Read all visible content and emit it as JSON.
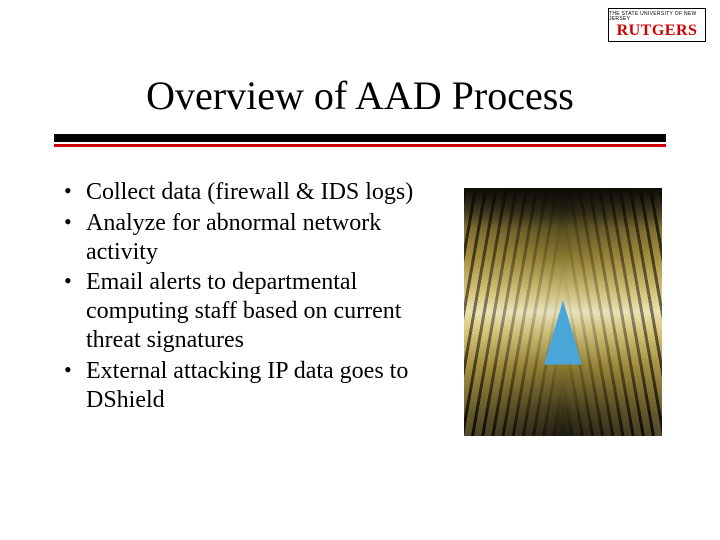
{
  "logo": {
    "topline": "THE STATE UNIVERSITY OF NEW JERSEY",
    "main": "RUTGERS"
  },
  "title": "Overview of AAD Process",
  "bullets": [
    "Collect data (firewall & IDS logs)",
    "Analyze for abnormal network activity",
    "Email alerts to departmental computing staff based on current threat signatures",
    "External attacking IP data goes to DShield"
  ],
  "colors": {
    "accent_red": "#cc0000",
    "divider_black": "#000000"
  },
  "image": {
    "name": "server-room-perspective"
  }
}
